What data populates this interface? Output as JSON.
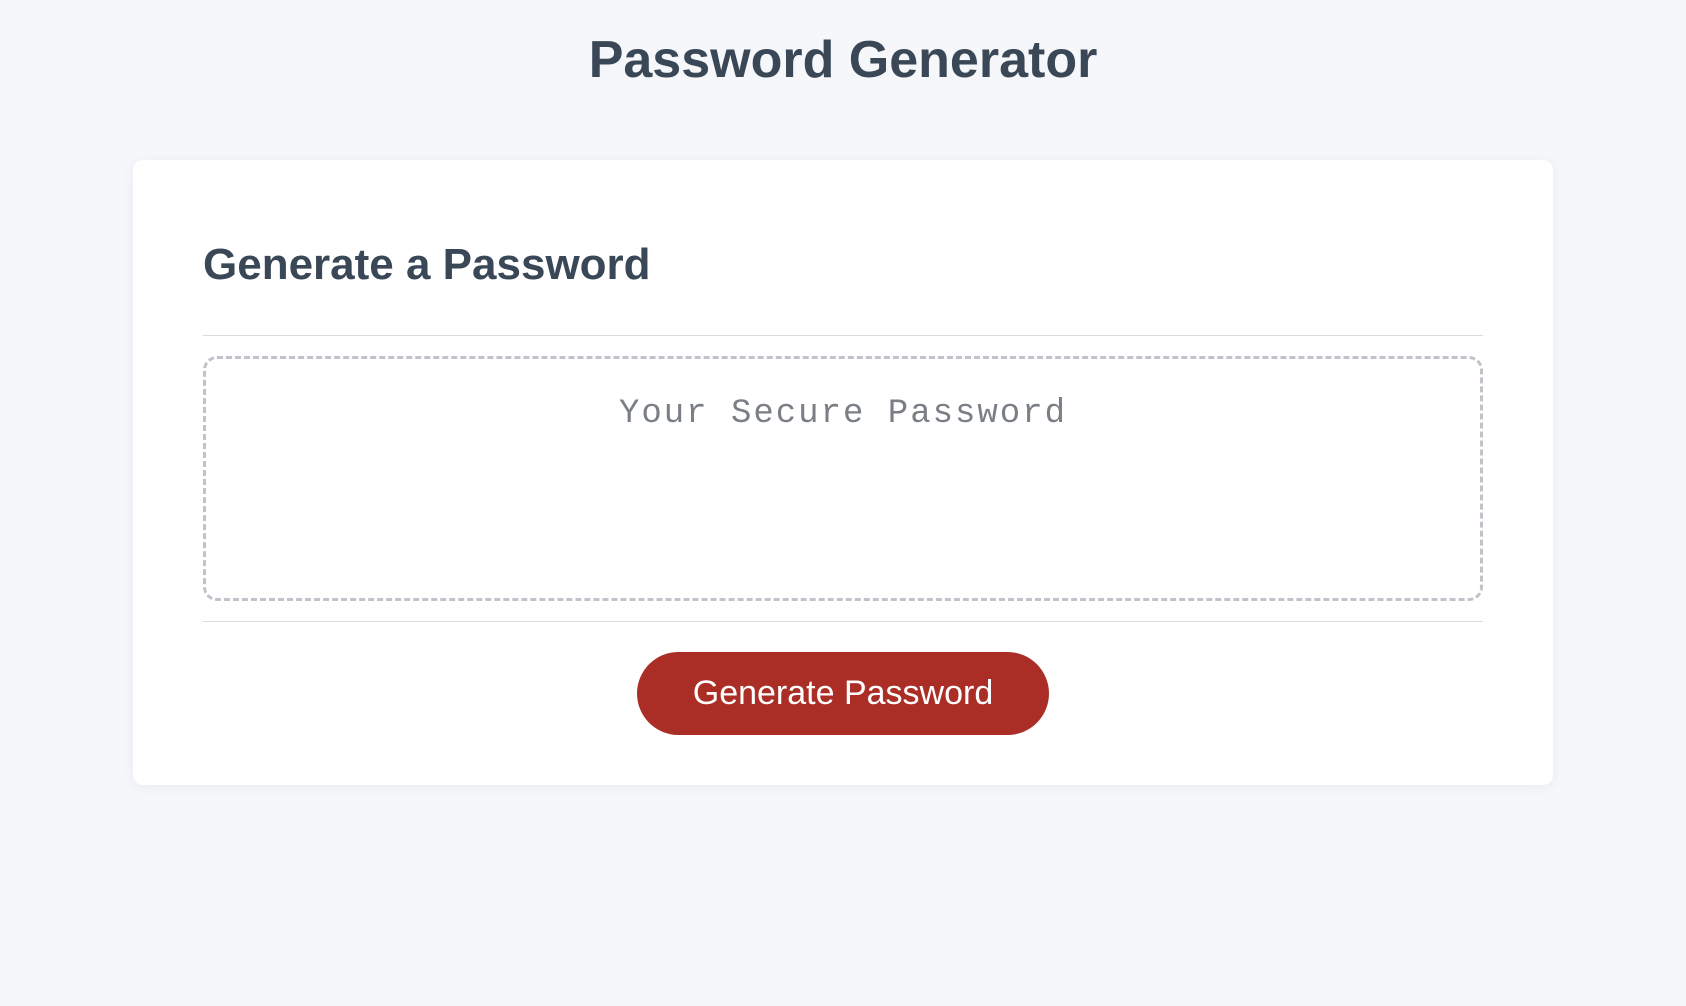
{
  "page": {
    "title": "Password Generator"
  },
  "card": {
    "heading": "Generate a Password",
    "password_placeholder": "Your Secure Password",
    "password_value": "",
    "generate_button_label": "Generate Password"
  }
}
